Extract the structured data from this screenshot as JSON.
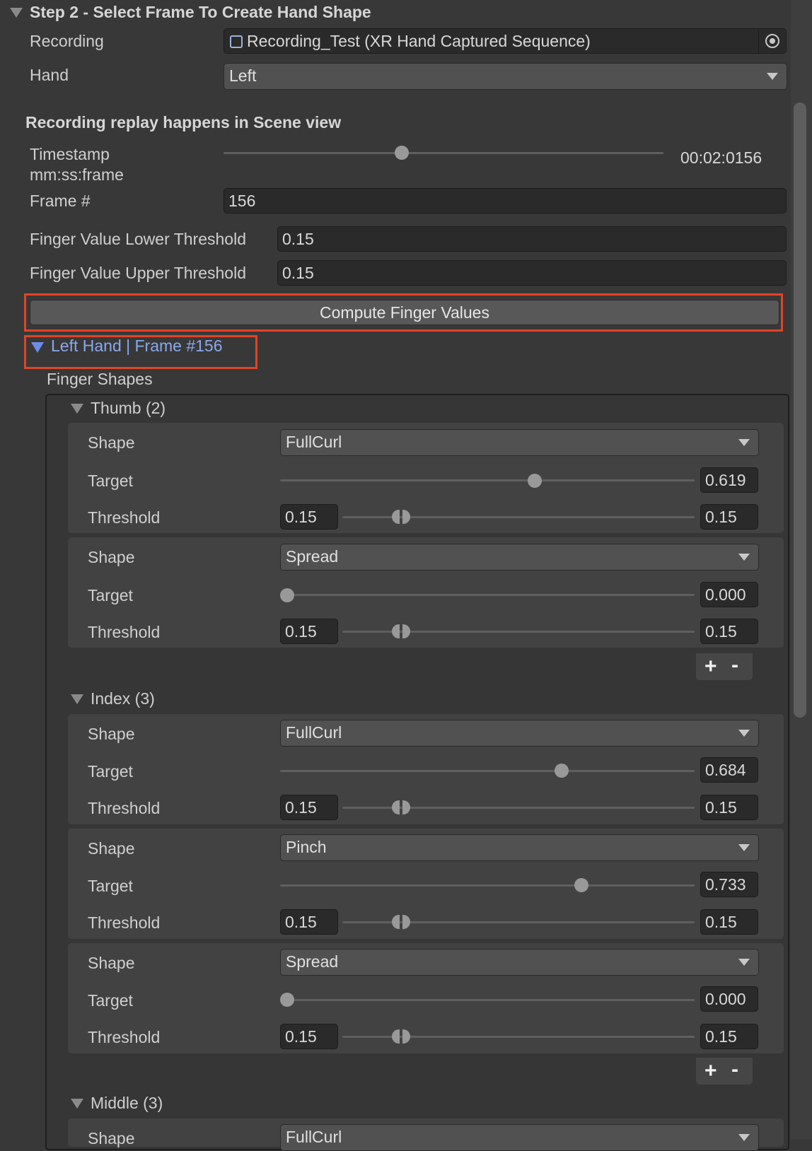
{
  "header": {
    "title": "Step 2 - Select Frame To Create Hand Shape"
  },
  "recording": {
    "label": "Recording",
    "value": "Recording_Test (XR Hand Captured Sequence)",
    "icon": "scriptable-object-icon"
  },
  "hand": {
    "label": "Hand",
    "value": "Left"
  },
  "replay_note": "Recording replay happens in Scene view",
  "timestamp": {
    "label_line1": "Timestamp",
    "label_line2": "mm:ss:frame",
    "value": "00:02:0156",
    "slider_fraction": 0.41
  },
  "frame": {
    "label": "Frame #",
    "value": "156"
  },
  "lower_threshold": {
    "label": "Finger Value Lower Threshold",
    "value": "0.15"
  },
  "upper_threshold": {
    "label": "Finger Value Upper Threshold",
    "value": "0.15"
  },
  "compute_button": "Compute Finger Values",
  "foldout": {
    "label": "Left Hand | Frame #156"
  },
  "finger_shapes_label": "Finger Shapes",
  "labels": {
    "shape": "Shape",
    "target": "Target",
    "threshold": "Threshold"
  },
  "fingers": {
    "thumb": {
      "title": "Thumb (2)",
      "shapes": [
        {
          "shape": "FullCurl",
          "target": "0.619",
          "thr_lo": "0.15",
          "thr_hi": "0.15"
        },
        {
          "shape": "Spread",
          "target": "0.000",
          "thr_lo": "0.15",
          "thr_hi": "0.15"
        }
      ]
    },
    "index": {
      "title": "Index (3)",
      "shapes": [
        {
          "shape": "FullCurl",
          "target": "0.684",
          "thr_lo": "0.15",
          "thr_hi": "0.15"
        },
        {
          "shape": "Pinch",
          "target": "0.733",
          "thr_lo": "0.15",
          "thr_hi": "0.15"
        },
        {
          "shape": "Spread",
          "target": "0.000",
          "thr_lo": "0.15",
          "thr_hi": "0.15"
        }
      ]
    },
    "middle": {
      "title": "Middle (3)",
      "shapes": [
        {
          "shape": "FullCurl"
        }
      ]
    }
  },
  "list_buttons": {
    "add": "+",
    "remove": "-"
  },
  "colors": {
    "background": "#383838",
    "highlight_outline": "#e04427",
    "foldout_text": "#8aa8ea"
  }
}
